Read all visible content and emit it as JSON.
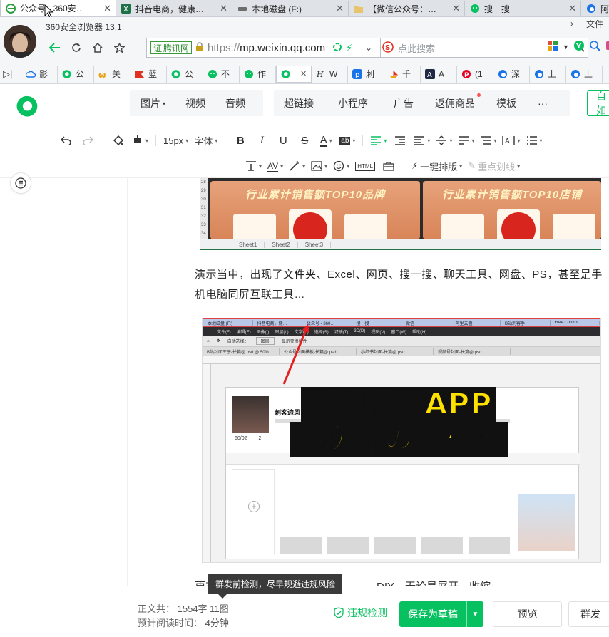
{
  "window_tabs": [
    {
      "icon": "ie-e-icon",
      "title": "公众号 - 360安…",
      "active": true
    },
    {
      "icon": "excel-icon",
      "title": "抖音电商，健康…",
      "active": false
    },
    {
      "icon": "drive-icon",
      "title": "本地磁盘 (F:)",
      "active": false
    },
    {
      "icon": "folder-icon",
      "title": "【微信公众号：…",
      "active": false
    },
    {
      "icon": "wechat-icon",
      "title": "搜一搜",
      "active": false
    },
    {
      "icon": "edge-icon",
      "title": "阿里",
      "active": false
    }
  ],
  "browser": {
    "name": "360安全浏览器 13.1",
    "file_menu": "文件",
    "cert_label": "腾讯网",
    "url_prefix": "https://",
    "url_host": "mp.weixin.qq.com",
    "search_placeholder": "点此搜索"
  },
  "bookmark_tabs": [
    {
      "icon": "cloud-icon",
      "label": "影"
    },
    {
      "icon": "wechat-mp-icon",
      "label": "公"
    },
    {
      "icon": "w-icon",
      "label": "关"
    },
    {
      "icon": "flag-icon",
      "label": "蓝"
    },
    {
      "icon": "wechat-mp-icon",
      "label": "公"
    },
    {
      "icon": "wechat-icon",
      "label": "不"
    },
    {
      "icon": "wechat-icon",
      "label": "作"
    },
    {
      "icon": "wechat-mp-icon",
      "label": "",
      "active": true
    },
    {
      "icon": "h-icon",
      "label": "W"
    },
    {
      "icon": "p-icon",
      "label": "刺"
    },
    {
      "icon": "boat-icon",
      "label": "千"
    },
    {
      "icon": "a-icon",
      "label": "A"
    },
    {
      "icon": "pinterest-icon",
      "label": "(1"
    },
    {
      "icon": "edge-icon",
      "label": "深"
    },
    {
      "icon": "edge-icon",
      "label": "上"
    },
    {
      "icon": "edge-icon",
      "label": "上"
    }
  ],
  "insert_menu": {
    "group1": [
      "图片",
      "视频",
      "音频"
    ],
    "group2": [
      "超链接",
      "小程序",
      "广告",
      "返佣商品",
      "模板",
      "···"
    ],
    "publish_partial": "自如"
  },
  "format_bar": {
    "font_size": "15px",
    "font_family": "字体",
    "one_click_layout": "一键排版",
    "highlight_line": "重点划线"
  },
  "article": {
    "excel_title_left": "行业累计销售额TOP10品牌",
    "excel_title_right": "行业累计销售额TOP10店铺",
    "excel_sheets": [
      "Sheet1",
      "Sheet2",
      "Sheet3"
    ],
    "para1_a": "演示当中，出现了",
    "para1_b": "文件夹、Excel、网页、搜一搜、聊天工具、网盘、PS，甚至是手机电脑同屏互联工具",
    "para1_c": "…",
    "ps_tabs": [
      "本地磁盘 (F:)",
      "抖音电商，健…",
      "公众号 - 360…",
      "搜一搜",
      "微信",
      "阿里云盘",
      "B站刺客手",
      "Free Control…"
    ],
    "ps_menu": [
      "文件(F)",
      "编辑(E)",
      "图像(I)",
      "图层(L)",
      "文字(Y)",
      "选择(S)",
      "滤镜(T)",
      "3D(D)",
      "视图(V)",
      "窗口(W)",
      "帮助(H)"
    ],
    "ps_opts": [
      "自动选择：",
      "图层",
      "显示变换控件"
    ],
    "ps_docs": [
      "B站封面王子-长篇@.psd @ 50%",
      "公众号封面模板-长篇@.psd",
      "小红书封面-长篇@.psd",
      "视频号封面-长篇@.psd"
    ],
    "profile_name": "刺客边风",
    "profile_counts": [
      "60/02",
      "2"
    ],
    "overlay_line1": "动漫神器APP",
    "overlay_line2": "二次元の黑科技",
    "para2": "更有意思的是，我们还可以对…………DIY，无论是屏开、收缩"
  },
  "footer": {
    "word_count_label": "正文共：",
    "word_count_value": "1554字 11图",
    "read_time_label": "预计阅读时间：",
    "read_time_value": "4分钟",
    "tooltip": "群发前检测，尽早规避违规风险",
    "check_label": "违规检测",
    "save_label": "保存为草稿",
    "preview_label": "预览",
    "mass_send_partial": "群发"
  },
  "colors": {
    "wechat_green": "#07c160",
    "overlay_yellow": "#ffe100"
  }
}
